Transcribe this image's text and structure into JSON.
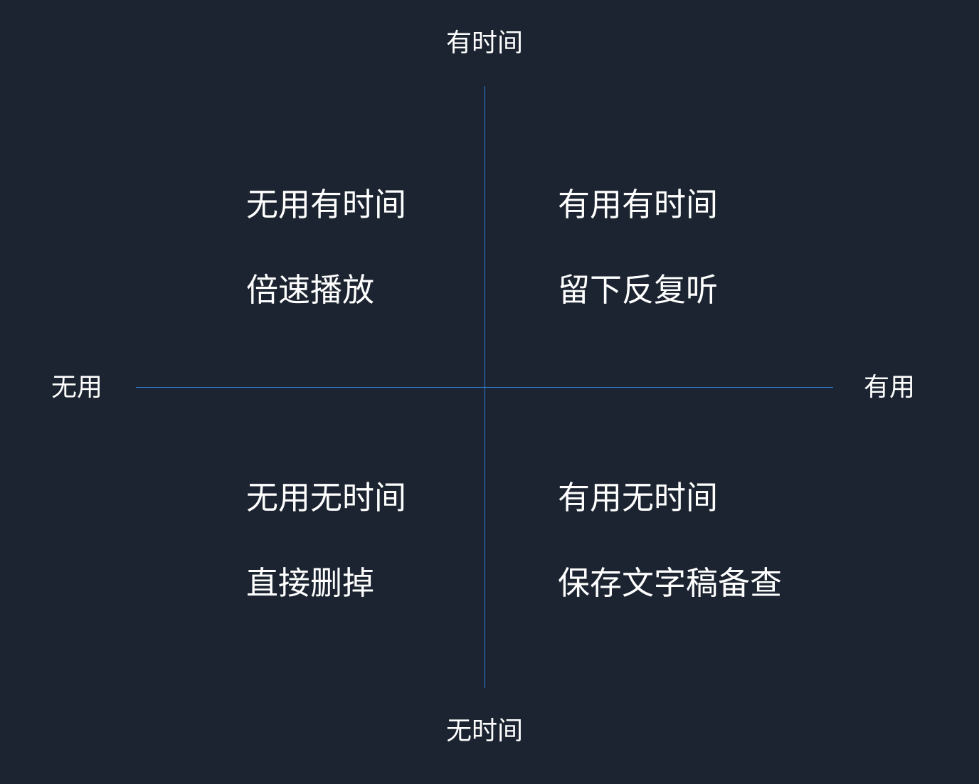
{
  "axes": {
    "top": "有时间",
    "bottom": "无时间",
    "left": "无用",
    "right": "有用",
    "line_color": "#2f7fd6"
  },
  "quadrants": {
    "top_left": {
      "title": "无用有时间",
      "action": "倍速播放"
    },
    "top_right": {
      "title": "有用有时间",
      "action": "留下反复听"
    },
    "bottom_left": {
      "title": "无用无时间",
      "action": "直接删掉"
    },
    "bottom_right": {
      "title": "有用无时间",
      "action": "保存文字稿备查"
    }
  },
  "colors": {
    "background": "#1b2430",
    "text": "#ffffff"
  }
}
